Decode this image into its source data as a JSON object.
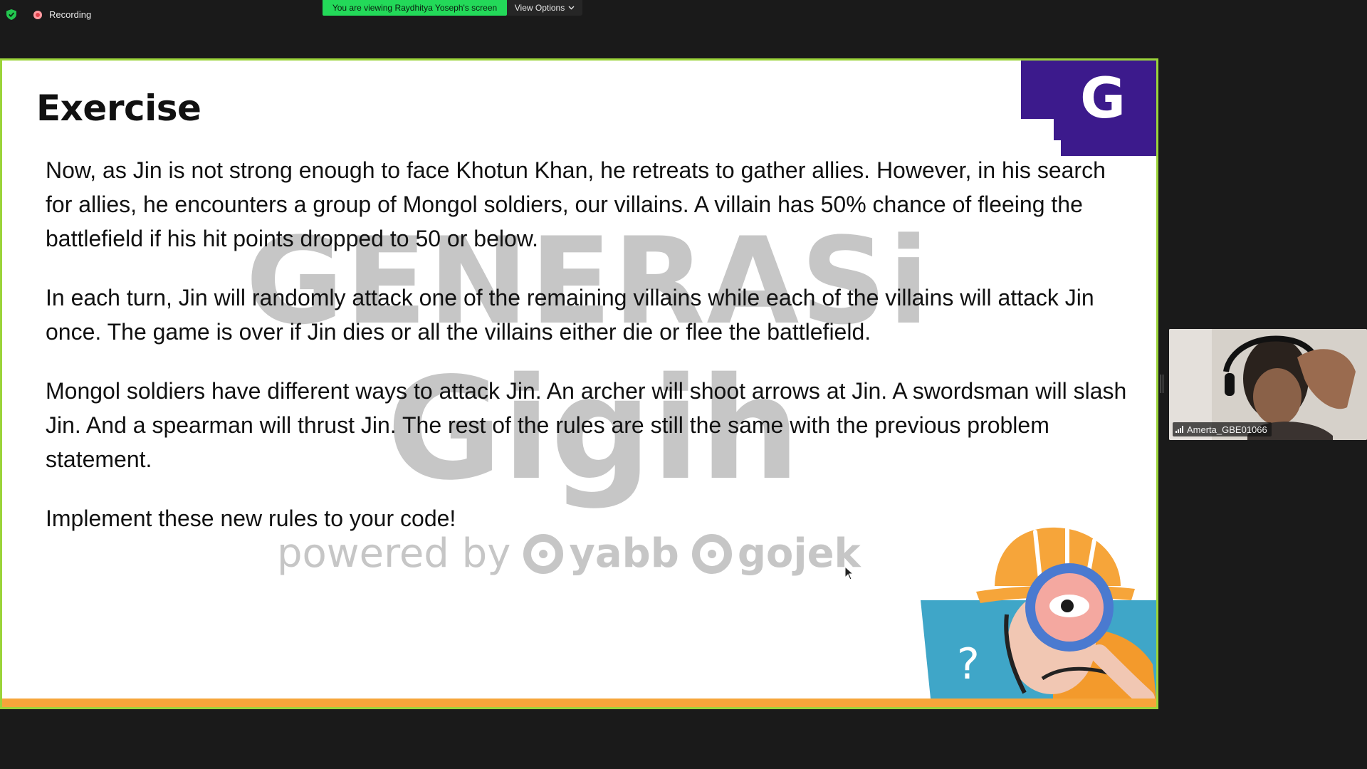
{
  "top_bar": {
    "recording_label": "Recording",
    "viewing_banner": "You are viewing Raydhitya Yoseph's screen",
    "view_options_label": "View Options"
  },
  "slide": {
    "title": "Exercise",
    "logo_letter": "G",
    "paragraphs": [
      "Now, as Jin is not strong enough to face Khotun Khan, he retreats to gather allies. However, in his search for allies, he encounters a group of Mongol soldiers, our villains. A villain has 50% chance of fleeing the battlefield if his hit points dropped to 50 or below.",
      "In each turn, Jin will randomly attack one of the remaining villains while each of the villains will attack Jin once. The game is over if Jin dies or all the villains either die or flee the battlefield.",
      "Mongol soldiers have different ways to attack Jin. An archer will shoot arrows at Jin. A swordsman will slash Jin. And a spearman will thrust Jin. The rest of the rules are still the same with the previous problem statement.",
      "Implement these new rules to your code!"
    ],
    "watermark": {
      "line1": "GENERASi",
      "line2": "Gigih",
      "powered_by": "powered by",
      "brand1": "yabb",
      "brand2": "gojek"
    },
    "illustration_mark": "?"
  },
  "participant": {
    "name": "Amerta_GBE01066"
  },
  "colors": {
    "share_border": "#9bd43a",
    "banner_green": "#23d959",
    "logo_purple": "#3c1a8c",
    "stripe_orange": "#f6a53a"
  }
}
